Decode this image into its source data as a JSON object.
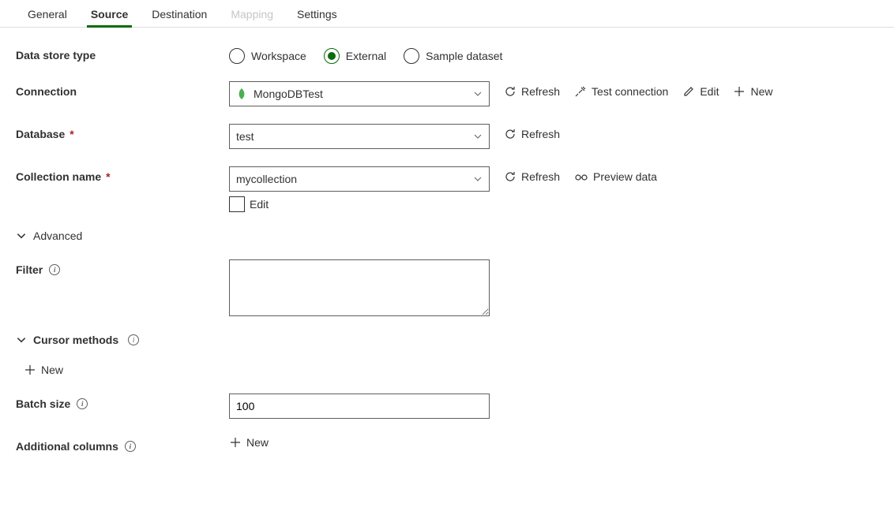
{
  "tabs": {
    "general": "General",
    "source": "Source",
    "destination": "Destination",
    "mapping": "Mapping",
    "settings": "Settings"
  },
  "labels": {
    "dataStoreType": "Data store type",
    "connection": "Connection",
    "database": "Database",
    "collectionName": "Collection name",
    "edit": "Edit",
    "advanced": "Advanced",
    "filter": "Filter",
    "cursorMethods": "Cursor methods",
    "batchSize": "Batch size",
    "additionalColumns": "Additional columns"
  },
  "radios": {
    "workspace": "Workspace",
    "external": "External",
    "sampleDataset": "Sample dataset"
  },
  "values": {
    "connection": "MongoDBTest",
    "database": "test",
    "collection": "mycollection",
    "filter": "",
    "batchSize": "100"
  },
  "actions": {
    "refresh": "Refresh",
    "testConnection": "Test connection",
    "edit": "Edit",
    "new": "New",
    "previewData": "Preview data"
  }
}
